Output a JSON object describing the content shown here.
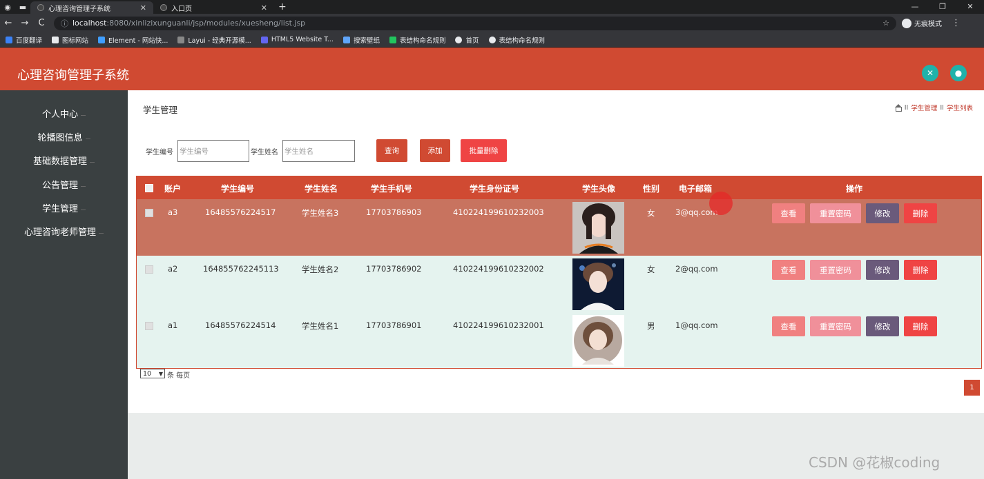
{
  "browser": {
    "tabs": [
      {
        "title": "心理咨询管理子系统",
        "active": true
      },
      {
        "title": "入口页",
        "active": false
      }
    ],
    "url_host": "localhost",
    "url_rest": ":8080/xinlizixunguanli/jsp/modules/xuesheng/list.jsp",
    "incognito_label": "无痕模式",
    "bookmarks": [
      "百度翻译",
      "图标网站",
      "Element - 网站快...",
      "Layui - 经典开源模...",
      "HTML5 Website T...",
      "搜索壁纸",
      "表结构命名规则",
      "首页",
      "表结构命名规则"
    ]
  },
  "header": {
    "title": "心理咨询管理子系统",
    "accent": "#d04a32"
  },
  "sidebar": {
    "items": [
      "个人中心",
      "轮播图信息",
      "基础数据管理",
      "公告管理",
      "学生管理",
      "心理咨询老师管理"
    ]
  },
  "page": {
    "heading": "学生管理",
    "breadcrumb": {
      "sep1": "II",
      "crumb1": "学生管理",
      "sep2": "II",
      "crumb2": "学生列表"
    }
  },
  "search": {
    "id_label": "学生编号",
    "id_placeholder": "学生编号",
    "name_label": "学生姓名",
    "name_placeholder": "学生姓名",
    "query_button": "查询",
    "add_button": "添加",
    "batch_delete_button": "批量删除"
  },
  "table": {
    "columns": [
      "账户",
      "学生编号",
      "学生姓名",
      "学生手机号",
      "学生身份证号",
      "学生头像",
      "性别",
      "电子邮箱",
      "操作"
    ],
    "rows": [
      {
        "account": "a3",
        "student_no": "16485576224517",
        "name": "学生姓名3",
        "phone": "17703786903",
        "id_card": "410224199610232003",
        "gender": "女",
        "email": "3@qq.com"
      },
      {
        "account": "a2",
        "student_no": "164855762245113",
        "name": "学生姓名2",
        "phone": "17703786902",
        "id_card": "410224199610232002",
        "gender": "女",
        "email": "2@qq.com"
      },
      {
        "account": "a1",
        "student_no": "16485576224514",
        "name": "学生姓名1",
        "phone": "17703786901",
        "id_card": "410224199610232001",
        "gender": "男",
        "email": "1@qq.com"
      }
    ],
    "actions": {
      "view": "查看",
      "reset_password": "重置密码",
      "edit": "修改",
      "delete": "删除"
    }
  },
  "pagination": {
    "page_size": "10",
    "page_size_label": "条 每页",
    "current_page": "1"
  },
  "watermark": "CSDN @花椒coding"
}
